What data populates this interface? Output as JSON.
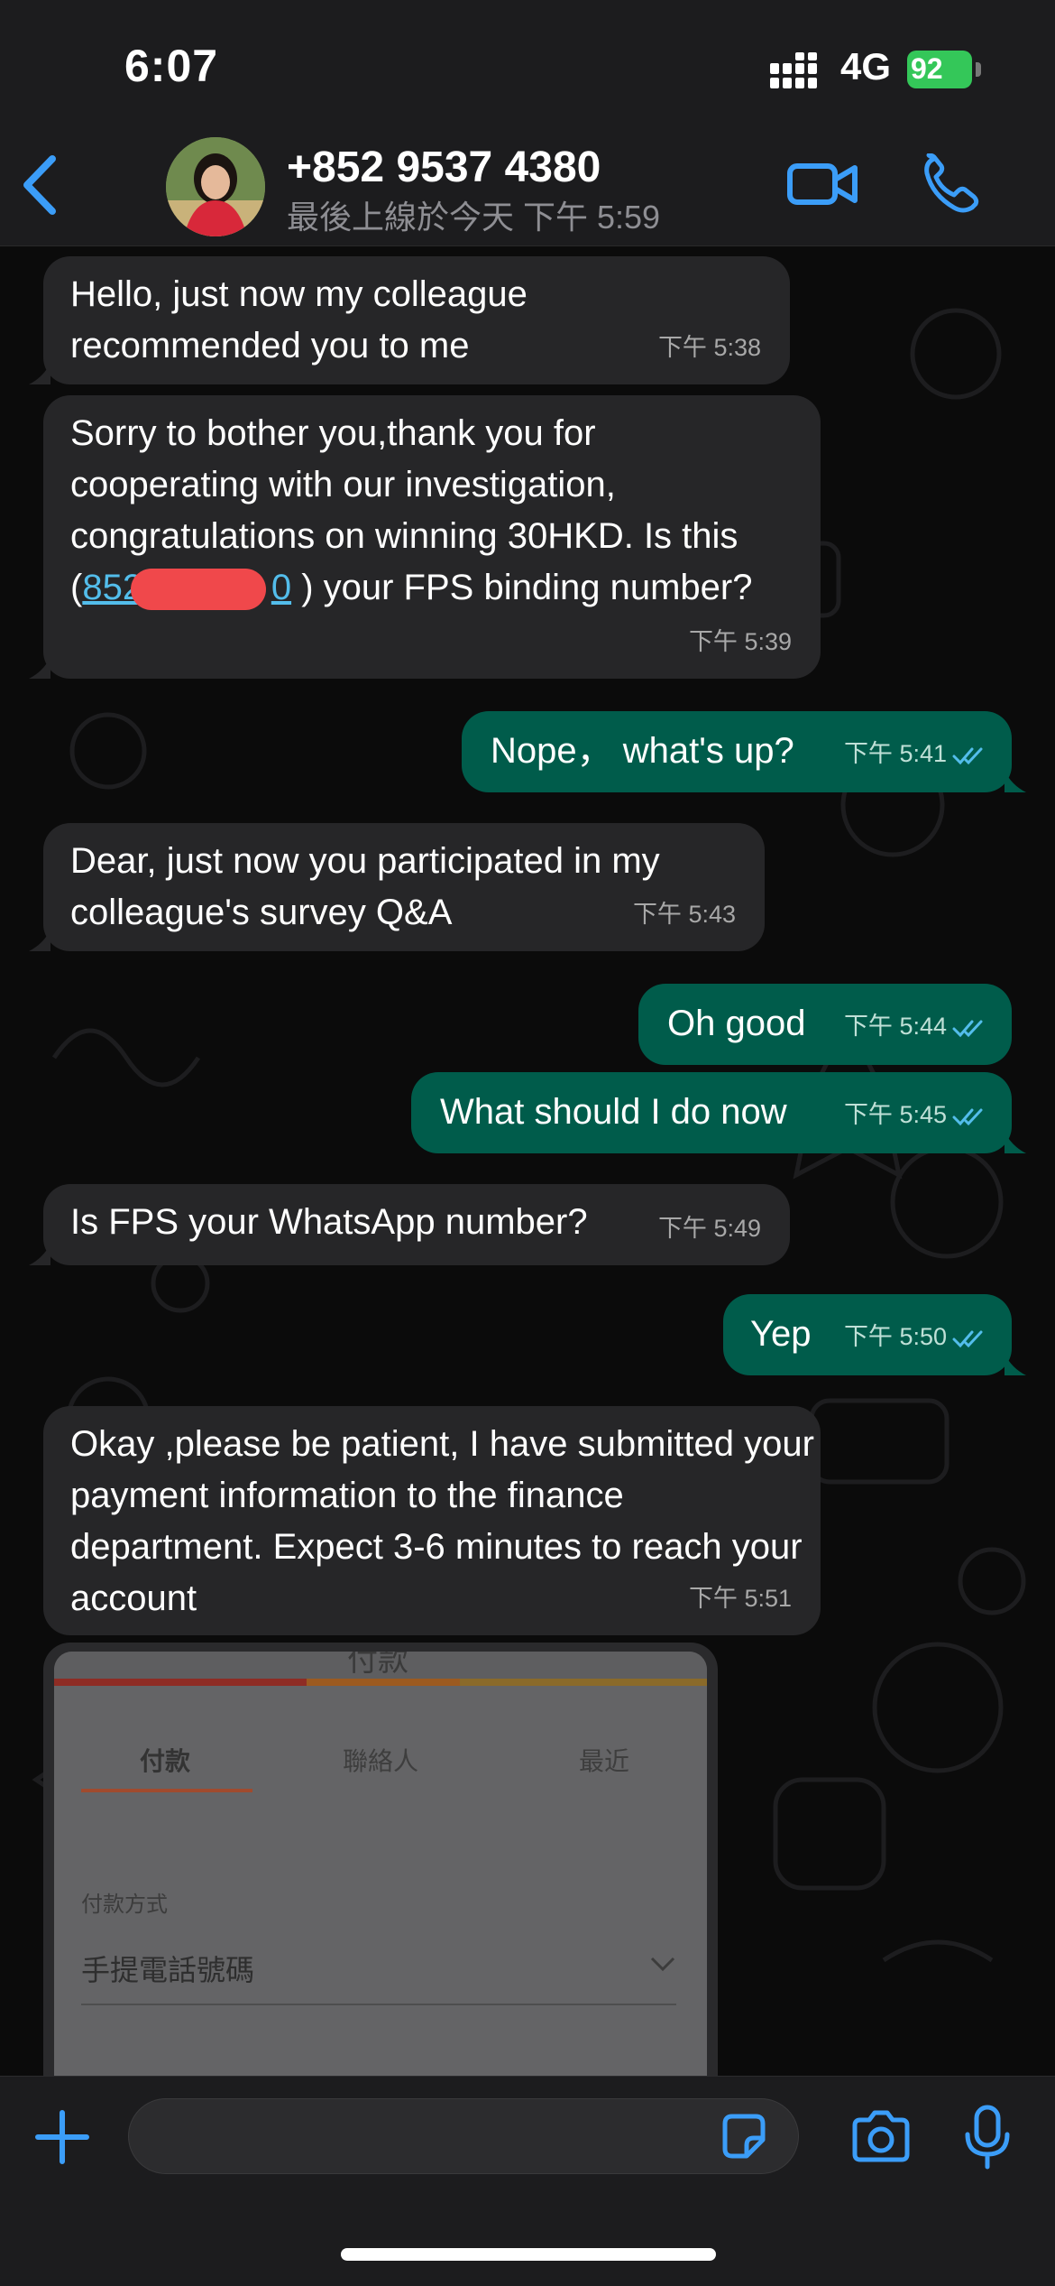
{
  "status_bar": {
    "time": "6:07",
    "network": "4G",
    "battery": "92"
  },
  "header": {
    "contact_name": "+852 9537 4380",
    "last_seen": "最後上線於今天 下午 5:59"
  },
  "messages": [
    {
      "direction": "in",
      "text": "Hello, just now my colleague recommended you to me",
      "time": "下午 5:38"
    },
    {
      "direction": "in",
      "text_before": "Sorry to bother you,thank you for cooperating with our investigation, congratulations on winning 30HKD. Is this (",
      "link": "852530",
      "link_tail": "0",
      "text_after": ") your FPS binding number?",
      "time": "下午 5:39"
    },
    {
      "direction": "out",
      "text": "Nope， what's up?",
      "time": "下午 5:41"
    },
    {
      "direction": "in",
      "text": "Dear, just now you participated in my colleague's survey Q&A",
      "time": "下午 5:43"
    },
    {
      "direction": "out",
      "text": "Oh good",
      "time": "下午 5:44"
    },
    {
      "direction": "out",
      "text": "What should I do now",
      "time": "下午 5:45"
    },
    {
      "direction": "in",
      "text": "Is FPS your WhatsApp number?",
      "time": "下午 5:49"
    },
    {
      "direction": "out",
      "text": "Yep",
      "time": "下午 5:50"
    },
    {
      "direction": "in",
      "text": "Okay ,please be patient, I have submitted your payment information to the finance department. Expect 3-6 minutes to reach your account",
      "time": "下午 5:51"
    }
  ],
  "embedded_image": {
    "top_text": "付款",
    "tabs": [
      "付款",
      "聯絡人",
      "最近"
    ],
    "field_label": "付款方式",
    "field_value": "手提電話號碼"
  },
  "input": {
    "placeholder": ""
  },
  "icons": {
    "back": "chevron-left-icon",
    "video": "video-camera-icon",
    "call": "phone-icon",
    "plus": "plus-icon",
    "sticker": "sticker-icon",
    "camera": "camera-icon",
    "mic": "microphone-icon",
    "read": "double-check-icon"
  },
  "colors": {
    "accent": "#3b9df8",
    "outgoing_bubble": "#005c4b",
    "incoming_bubble": "#262628",
    "read_tick": "#53bdeb",
    "battery": "#34c759"
  }
}
